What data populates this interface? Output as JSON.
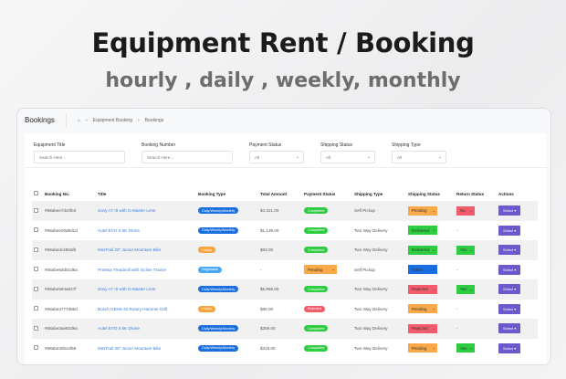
{
  "hero": {
    "title": "Equipment Rent / Booking",
    "subtitle": "hourly , daily , weekly, monthly"
  },
  "header": {
    "title": "Bookings",
    "breadcrumb": [
      "Equipment Booking",
      "Bookings"
    ]
  },
  "filters": [
    {
      "label": "Equipment Title",
      "placeholder": "Search Here...",
      "type": "input"
    },
    {
      "label": "Booking Number",
      "placeholder": "Search Here...",
      "type": "input"
    },
    {
      "label": "Payment Status",
      "value": "All",
      "type": "select"
    },
    {
      "label": "Shipping Status",
      "value": "All",
      "type": "select"
    },
    {
      "label": "Shipping Type",
      "value": "All",
      "type": "select"
    }
  ],
  "columns": [
    "Booking No.",
    "Title",
    "Booking Type",
    "Total Amount",
    "Payment Status",
    "Shipping Type",
    "Shipping Status",
    "Return Status",
    "Actions"
  ],
  "colors": {
    "daily": "#1a6fe0",
    "hourly": "#f7a440",
    "negotiable": "#4aa8f0",
    "completed": "#2ecc40",
    "rejected": "#f25c6a",
    "pending": "#f9a84a",
    "delivered": "#2ecc40",
    "taken": "#1a6fe0",
    "yes": "#2ecc40",
    "no": "#f25c6a",
    "action": "#6a5acd"
  },
  "rows": [
    {
      "no": "#68abee7dc0fed",
      "title": "Sony A7 III with G-Master Lens",
      "type": "Daily/Weekly/Monthly",
      "typeKey": "daily",
      "amount": "$4,321.00",
      "payment": "Completed",
      "paymentKey": "completed",
      "ship_type": "Self Pickup",
      "ship_status": "Pending",
      "shipKey": "pending",
      "return": "No",
      "returnKey": "no",
      "action": "Select"
    },
    {
      "no": "#68abee20d8d1d",
      "title": "Autel EVO II 8K Drone",
      "type": "Daily/Weekly/Monthly",
      "typeKey": "daily",
      "amount": "$1,139.00",
      "payment": "Completed",
      "paymentKey": "completed",
      "ship_type": "Two Way Delivery",
      "ship_status": "Delivered",
      "shipKey": "delivered",
      "return": "-",
      "returnKey": "",
      "action": "Select"
    },
    {
      "no": "#68abedc480af6",
      "title": "MiniTrail 20\" Junior Mountain Bike",
      "type": "Hourly",
      "typeKey": "hourly",
      "amount": "$63.00",
      "payment": "Completed",
      "paymentKey": "completed",
      "ship_type": "Two Way Delivery",
      "ship_status": "Delivered",
      "shipKey": "delivered",
      "return": "Yes",
      "returnKey": "yes",
      "action": "Select"
    },
    {
      "no": "#68abe6dd01d8a",
      "title": "ProMax Treadmill with Incline Trainer",
      "type": "Negotiable",
      "typeKey": "negotiable",
      "amount": "-",
      "payment": "Pending",
      "paymentKey": "pending",
      "paymentSelect": true,
      "ship_type": "Self Pickup",
      "ship_status": "Taken",
      "shipKey": "taken",
      "return": "-",
      "returnKey": "",
      "action": "Select"
    },
    {
      "no": "#68abe564a827f",
      "title": "Sony A7 III with G-Master Lens",
      "type": "Daily/Weekly/Monthly",
      "typeKey": "daily",
      "amount": "$5,966.00",
      "payment": "Completed",
      "paymentKey": "completed",
      "ship_type": "Two Way Delivery",
      "ship_status": "Rejected",
      "shipKey": "rejected",
      "return": "Yes",
      "returnKey": "yes",
      "action": "Select"
    },
    {
      "no": "#68abe4777d95d",
      "title": "Bosch GBH5-40 Rotary Hammer Drill",
      "type": "Hourly",
      "typeKey": "hourly",
      "amount": "$86.00",
      "payment": "Rejected",
      "paymentKey": "rejected",
      "ship_type": "Two Way Delivery",
      "ship_status": "Pending",
      "shipKey": "pending",
      "return": "-",
      "returnKey": "",
      "action": "Select"
    },
    {
      "no": "#68abe3ae82d9a",
      "title": "Autel EVO II 8K Drone",
      "type": "Daily/Weekly/Monthly",
      "typeKey": "daily",
      "amount": "$359.00",
      "payment": "Completed",
      "paymentKey": "completed",
      "ship_type": "Two Way Delivery",
      "ship_status": "Rejected",
      "shipKey": "rejected",
      "return": "-",
      "returnKey": "",
      "action": "Select"
    },
    {
      "no": "#68abe30bcef68",
      "title": "MiniTrail 20\" Junior Mountain Bike",
      "type": "Daily/Weekly/Monthly",
      "typeKey": "daily",
      "amount": "$319.00",
      "payment": "Completed",
      "paymentKey": "completed",
      "ship_type": "Two Way Delivery",
      "ship_status": "Pending",
      "shipKey": "pending",
      "return": "Yes",
      "returnKey": "yes",
      "action": "Select"
    }
  ]
}
